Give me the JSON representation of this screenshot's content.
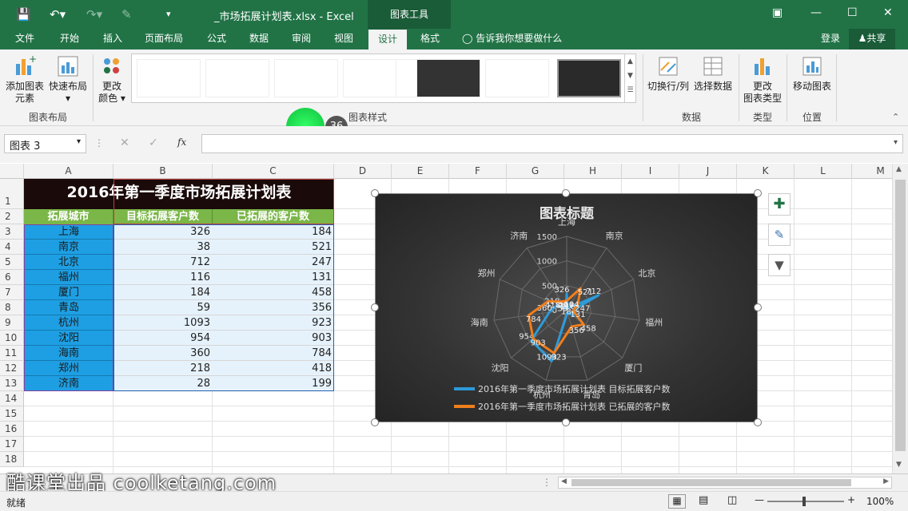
{
  "titlebar": {
    "doc_title": "_市场拓展计划表.xlsx - Excel",
    "context_tab": "图表工具"
  },
  "tabs": [
    "文件",
    "开始",
    "插入",
    "页面布局",
    "公式",
    "数据",
    "审阅",
    "视图",
    "设计",
    "格式"
  ],
  "tell_me": "告诉我你想要做什么",
  "signin": "登录",
  "share": "共享",
  "ribbon": {
    "add_chart_element_1": "添加图表",
    "add_chart_element_2": "元素",
    "quick_layout": "快速布局",
    "change_colors_1": "更改",
    "change_colors_2": "颜色",
    "switch_row_col": "切换行/列",
    "select_data": "选择数据",
    "change_type_1": "更改",
    "change_type_2": "图表类型",
    "move_chart": "移动图表",
    "group_layout": "图表布局",
    "group_styles": "图表样式",
    "group_data": "数据",
    "group_type": "类型",
    "group_location": "位置",
    "badge": "36"
  },
  "formula": {
    "namebox": "图表 3",
    "fx": "fx"
  },
  "columns": [
    "A",
    "B",
    "C",
    "D",
    "E",
    "F",
    "G",
    "H",
    "I",
    "J",
    "K",
    "L",
    "M"
  ],
  "rows": [
    "1",
    "2",
    "3",
    "4",
    "5",
    "6",
    "7",
    "8",
    "9",
    "10",
    "11",
    "12",
    "13",
    "14",
    "15",
    "16",
    "17",
    "18"
  ],
  "sheet": {
    "title": "2016年第一季度市场拓展计划表",
    "headers": [
      "拓展城市",
      "目标拓展客户数",
      "已拓展的客户数"
    ],
    "data": [
      [
        "上海",
        "326",
        "184"
      ],
      [
        "南京",
        "38",
        "521"
      ],
      [
        "北京",
        "712",
        "247"
      ],
      [
        "福州",
        "116",
        "131"
      ],
      [
        "厦门",
        "184",
        "458"
      ],
      [
        "青岛",
        "59",
        "356"
      ],
      [
        "杭州",
        "1093",
        "923"
      ],
      [
        "沈阳",
        "954",
        "903"
      ],
      [
        "海南",
        "360",
        "784"
      ],
      [
        "郑州",
        "218",
        "418"
      ],
      [
        "济南",
        "28",
        "199"
      ]
    ]
  },
  "chart_data": {
    "type": "radar",
    "title": "图表标题",
    "categories": [
      "上海",
      "南京",
      "北京",
      "福州",
      "厦门",
      "青岛",
      "杭州",
      "沈阳",
      "海南",
      "郑州",
      "济南"
    ],
    "axis_ticks": [
      "0",
      "500",
      "1000",
      "1500"
    ],
    "rmax": 1500,
    "series": [
      {
        "name": "2016年第一季度市场拓展计划表 目标拓展客户数",
        "values": [
          326,
          38,
          712,
          116,
          184,
          59,
          1093,
          954,
          360,
          218,
          28
        ],
        "color": "#2e9ad8"
      },
      {
        "name": "2016年第一季度市场拓展计划表 已拓展的客户数",
        "values": [
          184,
          521,
          247,
          131,
          458,
          356,
          923,
          903,
          784,
          418,
          199
        ],
        "color": "#f07f1e"
      }
    ]
  },
  "status": {
    "ready": "就绪",
    "zoom": "100%"
  },
  "watermark": "酷课堂出品 coolketang.com"
}
